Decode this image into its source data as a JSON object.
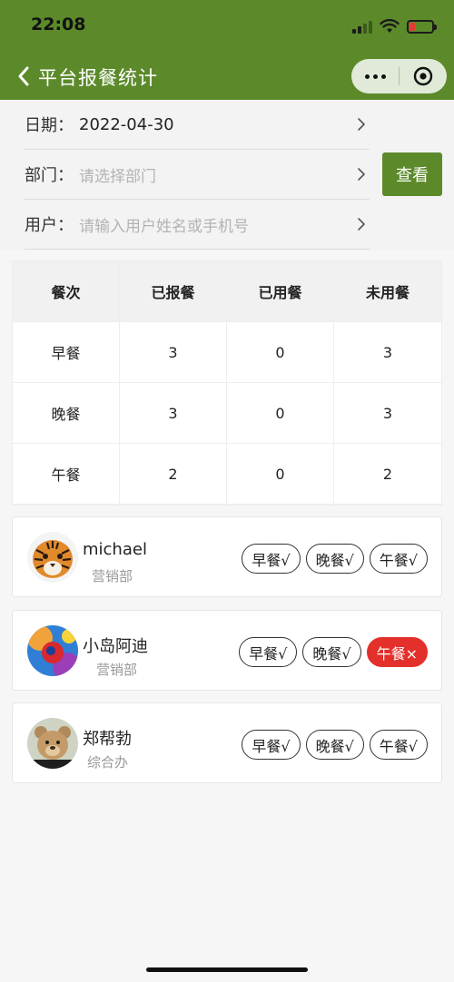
{
  "status_bar": {
    "time": "22:08"
  },
  "nav": {
    "title": "平台报餐统计",
    "back_icon": "chevron-left-icon",
    "capsule": {
      "more_icon": "ellipsis-icon",
      "close_icon": "target-circle-icon"
    }
  },
  "filters": {
    "date": {
      "label": "日期：",
      "value": "2022-04-30"
    },
    "department": {
      "label": "部门：",
      "placeholder": "请选择部门"
    },
    "user": {
      "label": "用户：",
      "placeholder": "请输入用户姓名或手机号"
    },
    "view_button": "查看"
  },
  "summary": {
    "headers": [
      "餐次",
      "已报餐",
      "已用餐",
      "未用餐"
    ],
    "rows": [
      [
        "早餐",
        "3",
        "0",
        "3"
      ],
      [
        "晚餐",
        "3",
        "0",
        "3"
      ],
      [
        "午餐",
        "2",
        "0",
        "2"
      ]
    ]
  },
  "members": [
    {
      "name": "michael",
      "department": "营销部",
      "avatar": "tiger-avatar",
      "meals": [
        {
          "label": "早餐√",
          "status": "ok"
        },
        {
          "label": "晚餐√",
          "status": "ok"
        },
        {
          "label": "午餐√",
          "status": "ok"
        }
      ]
    },
    {
      "name": "小岛阿迪",
      "department": "营销部",
      "avatar": "colorful-abstract-avatar",
      "meals": [
        {
          "label": "早餐√",
          "status": "ok"
        },
        {
          "label": "晚餐√",
          "status": "ok"
        },
        {
          "label": "午餐×",
          "status": "missed"
        }
      ]
    },
    {
      "name": "郑帮勃",
      "department": "综合办",
      "avatar": "teddy-bear-avatar",
      "meals": [
        {
          "label": "早餐√",
          "status": "ok"
        },
        {
          "label": "晚餐√",
          "status": "ok"
        },
        {
          "label": "午餐√",
          "status": "ok"
        }
      ]
    }
  ],
  "colors": {
    "brand_green": "#5c8a2b",
    "missed_red": "#e3302a"
  }
}
